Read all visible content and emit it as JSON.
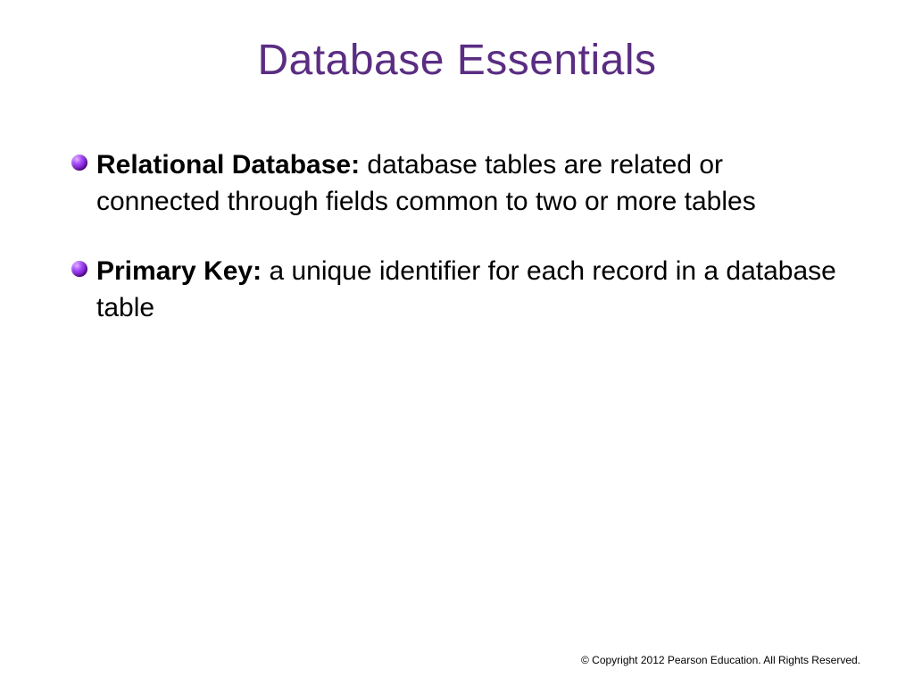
{
  "slide": {
    "title": "Database Essentials",
    "bullets": [
      {
        "term": "Relational Database:",
        "definition": " database tables are related or connected through fields common to two or more tables"
      },
      {
        "term": "Primary Key:",
        "definition": " a unique identifier for each record in a database table"
      }
    ],
    "copyright": "© Copyright 2012 Pearson Education. All Rights Reserved."
  }
}
